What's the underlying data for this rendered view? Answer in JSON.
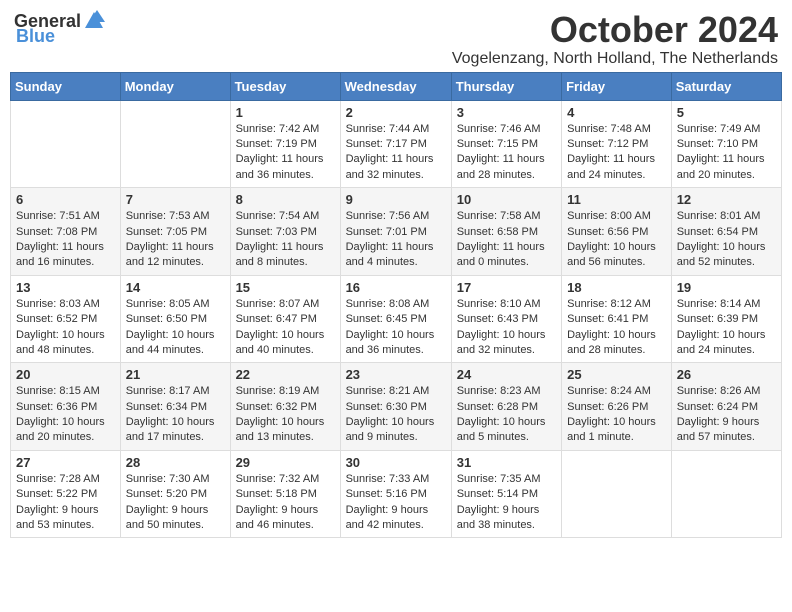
{
  "header": {
    "logo_general": "General",
    "logo_blue": "Blue",
    "month_title": "October 2024",
    "location": "Vogelenzang, North Holland, The Netherlands"
  },
  "days_of_week": [
    "Sunday",
    "Monday",
    "Tuesday",
    "Wednesday",
    "Thursday",
    "Friday",
    "Saturday"
  ],
  "weeks": [
    [
      {
        "day": "",
        "sunrise": "",
        "sunset": "",
        "daylight": ""
      },
      {
        "day": "",
        "sunrise": "",
        "sunset": "",
        "daylight": ""
      },
      {
        "day": "1",
        "sunrise": "Sunrise: 7:42 AM",
        "sunset": "Sunset: 7:19 PM",
        "daylight": "Daylight: 11 hours and 36 minutes."
      },
      {
        "day": "2",
        "sunrise": "Sunrise: 7:44 AM",
        "sunset": "Sunset: 7:17 PM",
        "daylight": "Daylight: 11 hours and 32 minutes."
      },
      {
        "day": "3",
        "sunrise": "Sunrise: 7:46 AM",
        "sunset": "Sunset: 7:15 PM",
        "daylight": "Daylight: 11 hours and 28 minutes."
      },
      {
        "day": "4",
        "sunrise": "Sunrise: 7:48 AM",
        "sunset": "Sunset: 7:12 PM",
        "daylight": "Daylight: 11 hours and 24 minutes."
      },
      {
        "day": "5",
        "sunrise": "Sunrise: 7:49 AM",
        "sunset": "Sunset: 7:10 PM",
        "daylight": "Daylight: 11 hours and 20 minutes."
      }
    ],
    [
      {
        "day": "6",
        "sunrise": "Sunrise: 7:51 AM",
        "sunset": "Sunset: 7:08 PM",
        "daylight": "Daylight: 11 hours and 16 minutes."
      },
      {
        "day": "7",
        "sunrise": "Sunrise: 7:53 AM",
        "sunset": "Sunset: 7:05 PM",
        "daylight": "Daylight: 11 hours and 12 minutes."
      },
      {
        "day": "8",
        "sunrise": "Sunrise: 7:54 AM",
        "sunset": "Sunset: 7:03 PM",
        "daylight": "Daylight: 11 hours and 8 minutes."
      },
      {
        "day": "9",
        "sunrise": "Sunrise: 7:56 AM",
        "sunset": "Sunset: 7:01 PM",
        "daylight": "Daylight: 11 hours and 4 minutes."
      },
      {
        "day": "10",
        "sunrise": "Sunrise: 7:58 AM",
        "sunset": "Sunset: 6:58 PM",
        "daylight": "Daylight: 11 hours and 0 minutes."
      },
      {
        "day": "11",
        "sunrise": "Sunrise: 8:00 AM",
        "sunset": "Sunset: 6:56 PM",
        "daylight": "Daylight: 10 hours and 56 minutes."
      },
      {
        "day": "12",
        "sunrise": "Sunrise: 8:01 AM",
        "sunset": "Sunset: 6:54 PM",
        "daylight": "Daylight: 10 hours and 52 minutes."
      }
    ],
    [
      {
        "day": "13",
        "sunrise": "Sunrise: 8:03 AM",
        "sunset": "Sunset: 6:52 PM",
        "daylight": "Daylight: 10 hours and 48 minutes."
      },
      {
        "day": "14",
        "sunrise": "Sunrise: 8:05 AM",
        "sunset": "Sunset: 6:50 PM",
        "daylight": "Daylight: 10 hours and 44 minutes."
      },
      {
        "day": "15",
        "sunrise": "Sunrise: 8:07 AM",
        "sunset": "Sunset: 6:47 PM",
        "daylight": "Daylight: 10 hours and 40 minutes."
      },
      {
        "day": "16",
        "sunrise": "Sunrise: 8:08 AM",
        "sunset": "Sunset: 6:45 PM",
        "daylight": "Daylight: 10 hours and 36 minutes."
      },
      {
        "day": "17",
        "sunrise": "Sunrise: 8:10 AM",
        "sunset": "Sunset: 6:43 PM",
        "daylight": "Daylight: 10 hours and 32 minutes."
      },
      {
        "day": "18",
        "sunrise": "Sunrise: 8:12 AM",
        "sunset": "Sunset: 6:41 PM",
        "daylight": "Daylight: 10 hours and 28 minutes."
      },
      {
        "day": "19",
        "sunrise": "Sunrise: 8:14 AM",
        "sunset": "Sunset: 6:39 PM",
        "daylight": "Daylight: 10 hours and 24 minutes."
      }
    ],
    [
      {
        "day": "20",
        "sunrise": "Sunrise: 8:15 AM",
        "sunset": "Sunset: 6:36 PM",
        "daylight": "Daylight: 10 hours and 20 minutes."
      },
      {
        "day": "21",
        "sunrise": "Sunrise: 8:17 AM",
        "sunset": "Sunset: 6:34 PM",
        "daylight": "Daylight: 10 hours and 17 minutes."
      },
      {
        "day": "22",
        "sunrise": "Sunrise: 8:19 AM",
        "sunset": "Sunset: 6:32 PM",
        "daylight": "Daylight: 10 hours and 13 minutes."
      },
      {
        "day": "23",
        "sunrise": "Sunrise: 8:21 AM",
        "sunset": "Sunset: 6:30 PM",
        "daylight": "Daylight: 10 hours and 9 minutes."
      },
      {
        "day": "24",
        "sunrise": "Sunrise: 8:23 AM",
        "sunset": "Sunset: 6:28 PM",
        "daylight": "Daylight: 10 hours and 5 minutes."
      },
      {
        "day": "25",
        "sunrise": "Sunrise: 8:24 AM",
        "sunset": "Sunset: 6:26 PM",
        "daylight": "Daylight: 10 hours and 1 minute."
      },
      {
        "day": "26",
        "sunrise": "Sunrise: 8:26 AM",
        "sunset": "Sunset: 6:24 PM",
        "daylight": "Daylight: 9 hours and 57 minutes."
      }
    ],
    [
      {
        "day": "27",
        "sunrise": "Sunrise: 7:28 AM",
        "sunset": "Sunset: 5:22 PM",
        "daylight": "Daylight: 9 hours and 53 minutes."
      },
      {
        "day": "28",
        "sunrise": "Sunrise: 7:30 AM",
        "sunset": "Sunset: 5:20 PM",
        "daylight": "Daylight: 9 hours and 50 minutes."
      },
      {
        "day": "29",
        "sunrise": "Sunrise: 7:32 AM",
        "sunset": "Sunset: 5:18 PM",
        "daylight": "Daylight: 9 hours and 46 minutes."
      },
      {
        "day": "30",
        "sunrise": "Sunrise: 7:33 AM",
        "sunset": "Sunset: 5:16 PM",
        "daylight": "Daylight: 9 hours and 42 minutes."
      },
      {
        "day": "31",
        "sunrise": "Sunrise: 7:35 AM",
        "sunset": "Sunset: 5:14 PM",
        "daylight": "Daylight: 9 hours and 38 minutes."
      },
      {
        "day": "",
        "sunrise": "",
        "sunset": "",
        "daylight": ""
      },
      {
        "day": "",
        "sunrise": "",
        "sunset": "",
        "daylight": ""
      }
    ]
  ]
}
